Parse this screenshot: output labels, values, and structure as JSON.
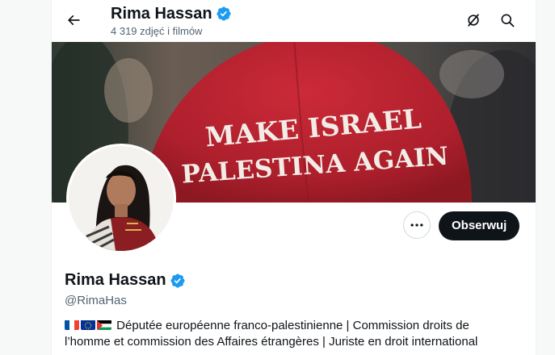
{
  "header": {
    "name": "Rima Hassan",
    "media_count": "4 319 zdjęć i filmów"
  },
  "banner": {
    "cap_line1": "MAKE ISRAEL",
    "cap_line2": "PALESTINA AGAIN"
  },
  "profile": {
    "name": "Rima Hassan",
    "handle": "@RimaHas",
    "follow_label": "Obserwuj",
    "bio_flags": [
      "flag-france-icon",
      "flag-eu-icon",
      "flag-palestine-icon"
    ],
    "bio_line1": "Députée européenne franco-palestinienne  | Commission droits de",
    "bio_line2": "l’homme et commission des Affaires étrangères | Juriste en droit international"
  },
  "colors": {
    "verified_blue": "#1d9bf0",
    "follow_button": "#0f1419",
    "cap_red": "#b5202e"
  }
}
